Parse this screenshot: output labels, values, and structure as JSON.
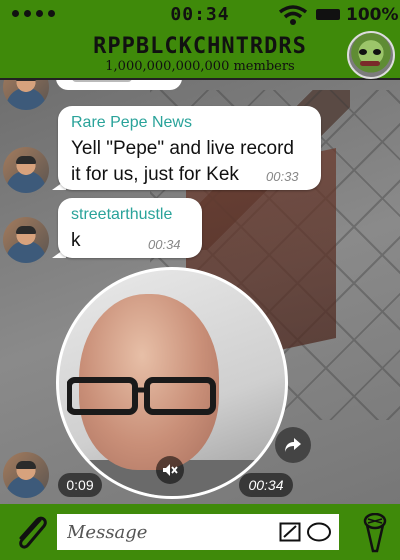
{
  "status_bar": {
    "time": "00:34",
    "battery": "100%"
  },
  "header": {
    "title": "RPPBLCKCHNTRDRS",
    "members": "1,000,000,000,000 members"
  },
  "messages": [
    {
      "sender": "Rare Pepe News",
      "lines": [
        "Yell \"Pepe\" and live record",
        "it for us, just for Kek"
      ],
      "time": "00:33"
    },
    {
      "sender": "streetarthustle",
      "lines": [
        "k"
      ],
      "time": "00:34"
    }
  ],
  "video_message": {
    "elapsed": "0:09",
    "time": "00:34"
  },
  "input_bar": {
    "placeholder": "Message"
  },
  "colors": {
    "bar_green": "#3f8a0a",
    "sender_teal": "#2aa39a"
  }
}
